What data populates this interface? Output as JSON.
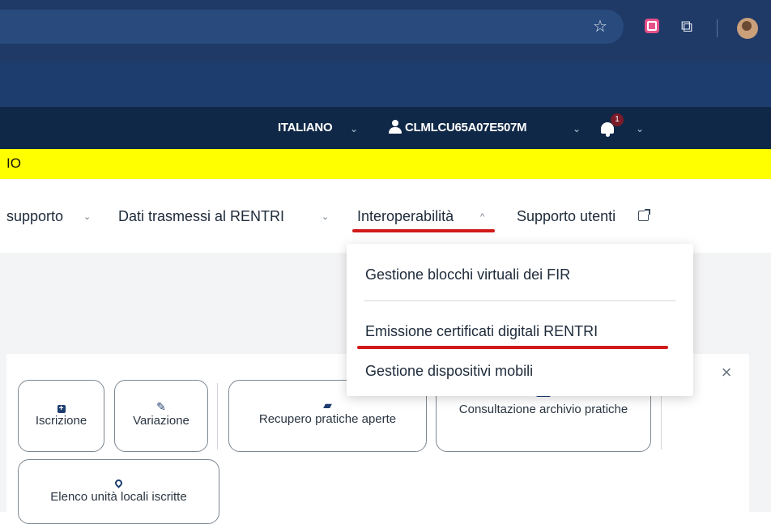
{
  "browser": {
    "star_icon": "star-icon",
    "extension_icon": "extension-icon",
    "puzzle_icon": "puzzle-icon",
    "avatar": "profile-avatar"
  },
  "header": {
    "language": "ITALIANO",
    "user_code": "CLMLCU65A07E507M",
    "notification_count": "1"
  },
  "banner": {
    "text": "IO"
  },
  "nav": {
    "items": [
      {
        "label": "supporto"
      },
      {
        "label": "Dati trasmessi al RENTRI"
      },
      {
        "label": "Interoperabilità"
      },
      {
        "label": "Supporto utenti"
      }
    ]
  },
  "dropdown": {
    "items": [
      {
        "label": "Gestione blocchi virtuali dei FIR"
      },
      {
        "label": "Emissione certificati digitali RENTRI"
      },
      {
        "label": "Gestione dispositivi mobili"
      }
    ]
  },
  "tiles": [
    {
      "label": "Iscrizione",
      "icon": "plus-square-icon"
    },
    {
      "label": "Variazione",
      "icon": "edit-icon"
    },
    {
      "label": "Recupero pratiche aperte",
      "icon": "folder-open-icon"
    },
    {
      "label": "Consultazione archivio pratiche",
      "icon": "archive-icon"
    },
    {
      "label": "Elenco unità locali iscritte",
      "icon": "map-pin-icon"
    }
  ],
  "colors": {
    "header_bg": "#102847",
    "banner_bg": "#ffff00",
    "accent_underline": "#d01a1a",
    "icon_blue": "#1e3d6f"
  }
}
